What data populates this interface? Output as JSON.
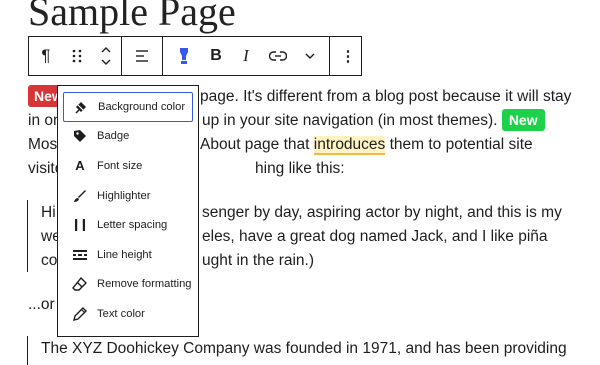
{
  "page_title": "Sample Page",
  "toolbar": {
    "paragraph_icon": "¶",
    "drag_icon": "drag-handle",
    "move_icon": "move-up-down",
    "align_icon": "align-left",
    "highlight_icon": "highlighter-tool",
    "bold_label": "B",
    "italic_label": "I",
    "link_icon": "link",
    "more_icon": "chevron-down",
    "options_icon": "⋮"
  },
  "paragraph1": {
    "badge_new_red": "New",
    "line1_tail": "page. It's different from a blog post because it will stay",
    "line2_a": "in on",
    "line2_b": "up in your site navigation (in most themes).",
    "badge_new_green": "New",
    "line3_a": "Most",
    "line3_b": "About page that",
    "line3_highlight": "introduces",
    "line3_c": "them to potential site",
    "line4_a": "visito",
    "line4_b": "hing like this:"
  },
  "quote": {
    "line1_a": "Hi",
    "line1_b": "senger by day, aspiring actor by night, and this is my",
    "line2_a": "we",
    "line2_b": "eles, have a great dog named Jack, and I like piña",
    "line3_a": "co",
    "line3_b": "ught in the rain.)"
  },
  "or_line": "...or s",
  "last_paragraph": "The XYZ Doohickey Company was founded in 1971, and has been providing",
  "format_menu": {
    "items": [
      {
        "label": "Background color",
        "icon": "paint-bucket-icon"
      },
      {
        "label": "Badge",
        "icon": "tag-icon"
      },
      {
        "label": "Font size",
        "icon": "letter-a-icon"
      },
      {
        "label": "Highlighter",
        "icon": "brush-icon"
      },
      {
        "label": "Letter spacing",
        "icon": "letter-spacing-icon"
      },
      {
        "label": "Line height",
        "icon": "line-height-icon"
      },
      {
        "label": "Remove formatting",
        "icon": "eraser-icon"
      },
      {
        "label": "Text color",
        "icon": "pencil-icon"
      }
    ]
  },
  "colors": {
    "accent": "#3858e9",
    "badge_red": "#d63638",
    "badge_green": "#1ed14b",
    "highlight_underline": "#f0b849"
  }
}
